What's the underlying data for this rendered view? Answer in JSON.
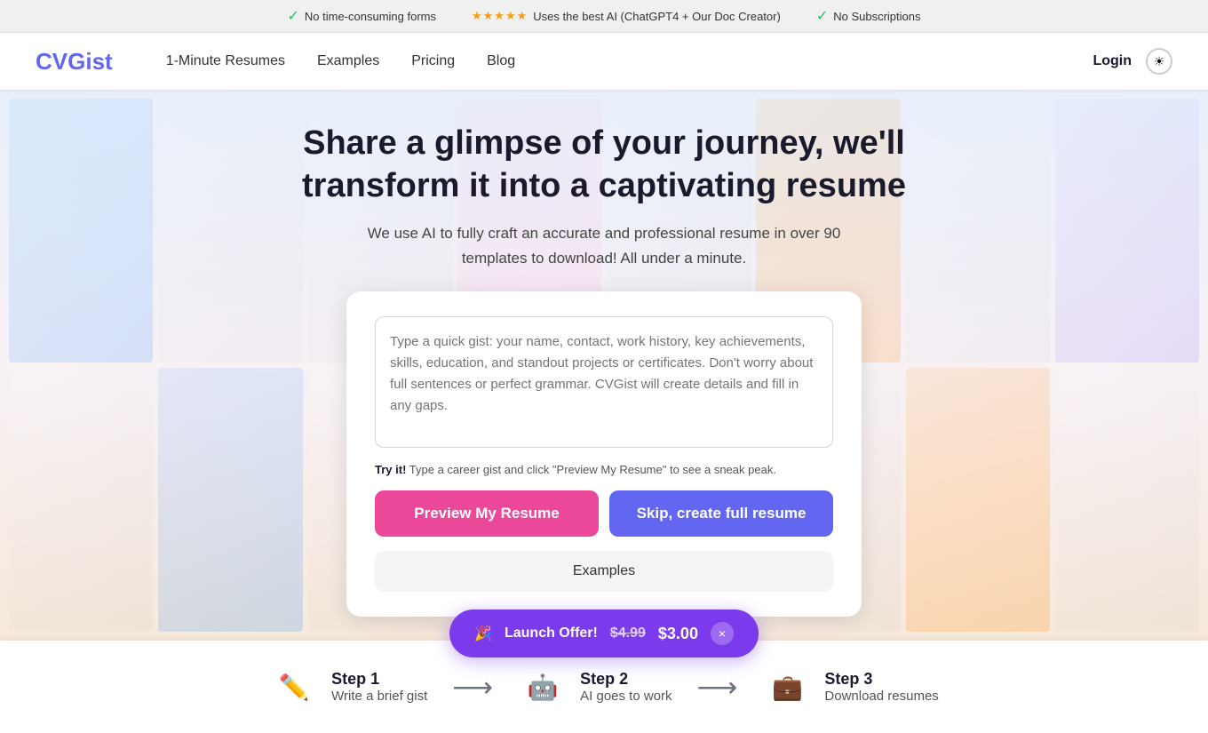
{
  "banner": {
    "item1": "No time-consuming forms",
    "stars": "★★★★★",
    "item2": "Uses the best AI (ChatGPT4 + Our Doc Creator)",
    "item3": "No Subscriptions"
  },
  "nav": {
    "logo": "CVGist",
    "links": [
      "1-Minute Resumes",
      "Examples",
      "Pricing",
      "Blog"
    ],
    "login": "Login",
    "theme_icon": "☀"
  },
  "hero": {
    "title_line1": "Share a glimpse of your journey, we'll",
    "title_line2": "transform it into a captivating resume",
    "subtitle": "We use AI to fully craft an accurate and professional resume in over 90 templates to download! All under a minute.",
    "textarea_placeholder": "Type a quick gist: your name, contact, work history, key achievements, skills, education, and standout projects or certificates. Don't worry about full sentences or perfect grammar. CVGist will create details and fill in any gaps.",
    "hint_label": "Try it!",
    "hint_text": " Type a career gist and click \"Preview My Resume\" to see a sneak peak.",
    "btn_preview": "Preview My Resume",
    "btn_skip": "Skip, create full resume",
    "btn_examples": "Examples"
  },
  "steps": [
    {
      "id": 1,
      "label": "Step 1",
      "desc": "Write a brief gist",
      "icon": "✏️"
    },
    {
      "id": 2,
      "label": "Step 2",
      "desc": "AI goes to work",
      "icon": "🤖"
    },
    {
      "id": 3,
      "label": "Step 3",
      "desc": "Download resumes",
      "icon": "💼"
    }
  ],
  "launch_offer": {
    "emoji": "🎉",
    "label": "Launch Offer!",
    "old_price": "$4.99",
    "new_price": "$3.00",
    "close": "×"
  }
}
